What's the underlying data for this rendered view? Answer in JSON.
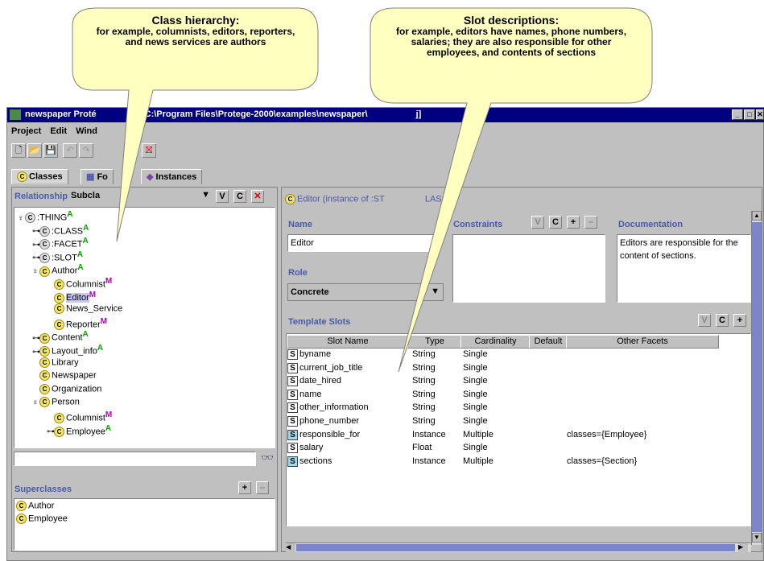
{
  "callouts": {
    "left": {
      "title": "Class hierarchy:",
      "body": "for example, columnists, editors, reporters, and news services are authors"
    },
    "right": {
      "title": "Slot descriptions:",
      "body": "for example, editors have names, phone numbers, salaries; they are also responsible for other employees, and contents of sections"
    }
  },
  "window": {
    "title_left": "newspaper  Proté",
    "title_right": "C:\\Program Files\\Protege-2000\\examples\\newspaper\\",
    "title_end": "j]"
  },
  "menu": [
    "Project",
    "Edit",
    "Wind"
  ],
  "tabs": {
    "classes": "Classes",
    "forms": "Fo",
    "instances": "Instances"
  },
  "left_panel": {
    "relationship_label": "Relationship:",
    "relationship_value": "Subcla",
    "tree": [
      {
        "name": ":THING",
        "flag": "A",
        "depth": 0
      },
      {
        "name": ":CLASS",
        "flag": "A",
        "depth": 1
      },
      {
        "name": ":FACET",
        "flag": "A",
        "depth": 1
      },
      {
        "name": ":SLOT",
        "flag": "A",
        "depth": 1
      },
      {
        "name": "Author",
        "flag": "A",
        "depth": 1
      },
      {
        "name": "Columnist",
        "flag": "M",
        "depth": 2
      },
      {
        "name": "Editor",
        "flag": "M",
        "depth": 2
      },
      {
        "name": "News_Service",
        "flag": "",
        "depth": 2
      },
      {
        "name": "Reporter",
        "flag": "M",
        "depth": 2
      },
      {
        "name": "Content",
        "flag": "A",
        "depth": 1
      },
      {
        "name": "Layout_info",
        "flag": "A",
        "depth": 1
      },
      {
        "name": "Library",
        "flag": "",
        "depth": 1
      },
      {
        "name": "Newspaper",
        "flag": "",
        "depth": 1
      },
      {
        "name": "Organization",
        "flag": "",
        "depth": 1
      },
      {
        "name": "Person",
        "flag": "",
        "depth": 1
      },
      {
        "name": "Columnist",
        "flag": "M",
        "depth": 2
      },
      {
        "name": "Employee",
        "flag": "A",
        "depth": 2
      }
    ],
    "superclasses_label": "Superclasses",
    "superclasses": [
      "Author",
      "Employee"
    ]
  },
  "right_panel": {
    "header": "Editor   (instance of :ST",
    "header_end": "LASS)",
    "name_label": "Name",
    "name_value": "Editor",
    "constraints_label": "Constraints",
    "documentation_label": "Documentation",
    "documentation_value": "Editors are responsible for the content of sections.",
    "role_label": "Role",
    "role_value": "Concrete",
    "template_slots_label": "Template Slots",
    "columns": [
      "Slot Name",
      "Type",
      "Cardinality",
      "Default",
      "Other Facets"
    ],
    "slots": [
      {
        "name": "byname",
        "type": "String",
        "card": "Single",
        "facets": ""
      },
      {
        "name": "current_job_title",
        "type": "String",
        "card": "Single",
        "facets": ""
      },
      {
        "name": "date_hired",
        "type": "String",
        "card": "Single",
        "facets": ""
      },
      {
        "name": "name",
        "type": "String",
        "card": "Single",
        "facets": ""
      },
      {
        "name": "other_information",
        "type": "String",
        "card": "Single",
        "facets": ""
      },
      {
        "name": "phone_number",
        "type": "String",
        "card": "Single",
        "facets": ""
      },
      {
        "name": "responsible_for",
        "type": "Instance",
        "card": "Multiple",
        "facets": "classes={Employee}"
      },
      {
        "name": "salary",
        "type": "Float",
        "card": "Single",
        "facets": ""
      },
      {
        "name": "sections",
        "type": "Instance",
        "card": "Multiple",
        "facets": "classes={Section}"
      }
    ]
  },
  "buttons": {
    "v": "V",
    "c": "C",
    "x": "✕",
    "plus": "+",
    "minus": "–"
  }
}
